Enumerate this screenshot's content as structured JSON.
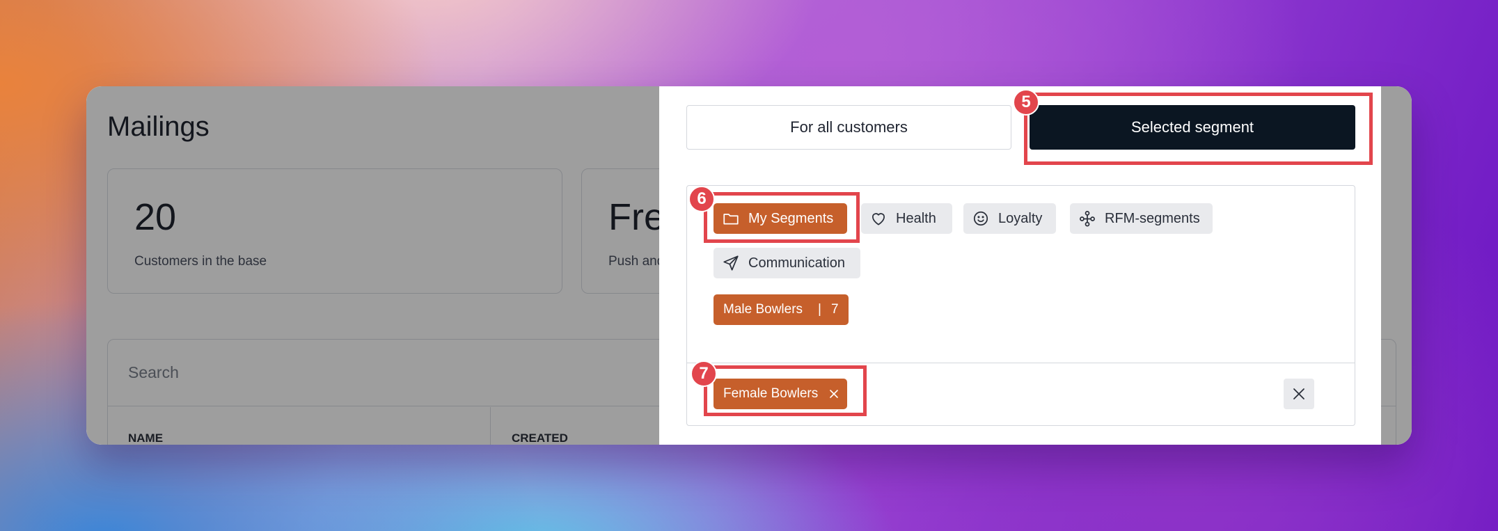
{
  "app": {
    "page_title": "Mailings",
    "stats": [
      {
        "value": "20",
        "label": "Customers in the base"
      },
      {
        "value": "Fre",
        "label": "Push and"
      }
    ],
    "search": {
      "placeholder": "Search",
      "value": ""
    },
    "table_columns": [
      "NAME",
      "CREATED"
    ]
  },
  "panel": {
    "audience_options": {
      "all": "For all customers",
      "selected": "Selected segment"
    },
    "active_audience": "selected",
    "segment_tabs": [
      {
        "label": "My Segments",
        "icon": "folder-icon",
        "active": true
      },
      {
        "label": "Health",
        "icon": "heart-icon",
        "active": false
      },
      {
        "label": "Loyalty",
        "icon": "smile-icon",
        "active": false
      },
      {
        "label": "RFM-segments",
        "icon": "network-icon",
        "active": false
      },
      {
        "label": "Communication",
        "icon": "send-icon",
        "active": false
      }
    ],
    "segments": [
      {
        "name": "Male Bowlers",
        "separator": "|",
        "count": "7"
      }
    ],
    "selected_segments": [
      {
        "name": "Female Bowlers"
      }
    ]
  },
  "annotations": {
    "steps": [
      "5",
      "6",
      "7"
    ],
    "highlight_color": "#e2454c"
  },
  "colors": {
    "accent": "#c65f2b",
    "dark_button": "#0b1622",
    "chip_bg": "#e9eaed"
  }
}
